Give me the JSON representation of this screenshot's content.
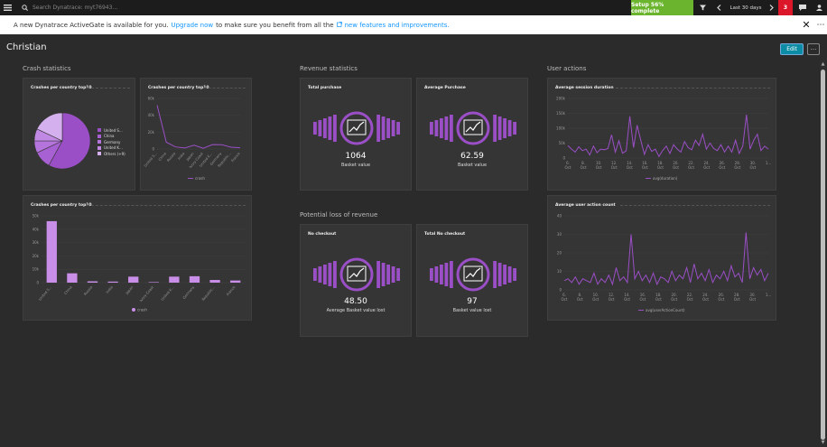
{
  "topbar": {
    "search_placeholder": "Search Dynatrace: myt76943...",
    "setup_label": "Setup 56% complete",
    "timeframe": "Last 30 days",
    "problems_count": "3",
    "icons": [
      "menu-icon",
      "search-icon",
      "filter-icon",
      "chevron-left-icon",
      "chevron-right-icon",
      "chat-icon",
      "user-icon"
    ]
  },
  "banner": {
    "text_before": "A new Dynatrace ActiveGate is available for you.",
    "link1": "Upgrade now",
    "text_middle": "to make sure you benefit from all the",
    "link2": "new features and improvements."
  },
  "dashboard": {
    "title": "Christian",
    "edit_label": "Edit",
    "more_label": "···"
  },
  "sections": {
    "crash": "Crash statistics",
    "revenue": "Revenue statistics",
    "user": "User actions",
    "loss": "Potential loss of revenue"
  },
  "colors": {
    "accent": "#9b4fc7",
    "light": "#c98ee8",
    "setup_green": "#6bb52e",
    "problem_red": "#dc172a",
    "edit_teal": "#0d8ca6"
  },
  "tiles": {
    "pie": {
      "title": "Crashes per country top10",
      "legend": [
        "United S...",
        "China",
        "Germany",
        "United K...",
        "Others (+9)"
      ]
    },
    "line_country": {
      "title": "Crashes per country top10",
      "legend": "crash"
    },
    "bar_country": {
      "title": "Crashes per country top10",
      "legend": "crash"
    },
    "total_purchase": {
      "title": "Total purchase",
      "value": "1064",
      "label": "Basket value"
    },
    "avg_purchase": {
      "title": "Average Purchase",
      "value": "62.59",
      "label": "Basket value"
    },
    "no_checkout": {
      "title": "No checkout",
      "value": "48.50",
      "label": "Average Basket value lost"
    },
    "total_no_checkout": {
      "title": "Total No checkout",
      "value": "97",
      "label": "Basket value lost"
    },
    "session": {
      "title": "Average session duration",
      "legend": "avg(duration)"
    },
    "action_count": {
      "title": "Average user action count",
      "legend": "avg(userActionCount)"
    }
  },
  "chart_data": [
    {
      "type": "pie",
      "title": "Crashes per country top10",
      "categories": [
        "United S...",
        "China",
        "Germany",
        "United K...",
        "Others (+9)"
      ],
      "values": [
        58,
        10,
        7,
        7,
        18
      ],
      "colors": [
        "#9b4fc7",
        "#a861d2",
        "#b574dc",
        "#c289e4",
        "#d4b0ee"
      ]
    },
    {
      "type": "line",
      "title": "Crashes per country top10",
      "categories": [
        "United S...",
        "China",
        "Russia",
        "India",
        "Japan",
        "Ivory Coast",
        "United K...",
        "Germany",
        "Republic...",
        "France"
      ],
      "ylim": [
        0,
        60000
      ],
      "yticks": [
        "0",
        "20k",
        "40k",
        "60k"
      ],
      "series": [
        {
          "name": "crash",
          "values": [
            52000,
            8000,
            2500,
            1200,
            4500,
            900,
            5200,
            5000,
            2100,
            1500
          ]
        }
      ]
    },
    {
      "type": "bar",
      "title": "Crashes per country top10",
      "categories": [
        "United S...",
        "China",
        "Russia",
        "India",
        "Japan",
        "Ivory Coast",
        "United K...",
        "Germany",
        "Republic...",
        "France"
      ],
      "ylim": [
        0,
        50000
      ],
      "yticks": [
        "0",
        "10k",
        "20k",
        "30k",
        "40k",
        "50k"
      ],
      "series": [
        {
          "name": "crash",
          "values": [
            46000,
            7000,
            1000,
            800,
            4500,
            400,
            4500,
            4800,
            2000,
            1600
          ]
        }
      ]
    },
    {
      "type": "line",
      "title": "Average session duration",
      "x": [
        "6. Oct",
        "8. Oct",
        "10. Oct",
        "12. Oct",
        "14. Oct",
        "16. Oct",
        "18. Oct",
        "20. Oct",
        "22. Oct",
        "24. Oct",
        "26. Oct",
        "28. Oct",
        "30. Oct",
        "1..."
      ],
      "ylim": [
        0,
        200000
      ],
      "yticks": [
        "0",
        "50k",
        "100k",
        "150k",
        "200k"
      ],
      "series": [
        {
          "name": "avg(duration)",
          "values": [
            42000,
            30000,
            20000,
            38000,
            25000,
            30000,
            10000,
            40000,
            18000,
            30000,
            28000,
            32000,
            78000,
            20000,
            58000,
            16000,
            24000,
            140000,
            35000,
            110000,
            60000,
            12000,
            45000,
            22000,
            30000,
            5000,
            25000,
            40000,
            15000,
            45000,
            30000,
            20000,
            55000,
            35000,
            28000,
            60000,
            42000,
            80000,
            30000,
            50000,
            32000,
            25000,
            45000,
            20000,
            40000,
            20000,
            60000,
            15000,
            40000,
            145000,
            30000,
            60000,
            80000,
            25000,
            40000,
            30000
          ]
        }
      ]
    },
    {
      "type": "line",
      "title": "Average user action count",
      "x": [
        "6. Oct",
        "8. Oct",
        "10. Oct",
        "12. Oct",
        "14. Oct",
        "16. Oct",
        "18. Oct",
        "20. Oct",
        "22. Oct",
        "24. Oct",
        "26. Oct",
        "28. Oct",
        "30. Oct",
        "1..."
      ],
      "ylim": [
        0,
        40
      ],
      "yticks": [
        "0",
        "10",
        "20",
        "30",
        "40"
      ],
      "series": [
        {
          "name": "avg(userActionCount)",
          "values": [
            5,
            6,
            4,
            7,
            3,
            6,
            5,
            4,
            9,
            3,
            6,
            4,
            8,
            3,
            12,
            5,
            7,
            4,
            30,
            6,
            10,
            5,
            8,
            4,
            9,
            3,
            7,
            6,
            4,
            10,
            5,
            8,
            6,
            12,
            4,
            14,
            6,
            9,
            5,
            11,
            4,
            8,
            6,
            10,
            5,
            13,
            7,
            9,
            4,
            31,
            6,
            12,
            8,
            11,
            5,
            9
          ]
        }
      ]
    }
  ]
}
